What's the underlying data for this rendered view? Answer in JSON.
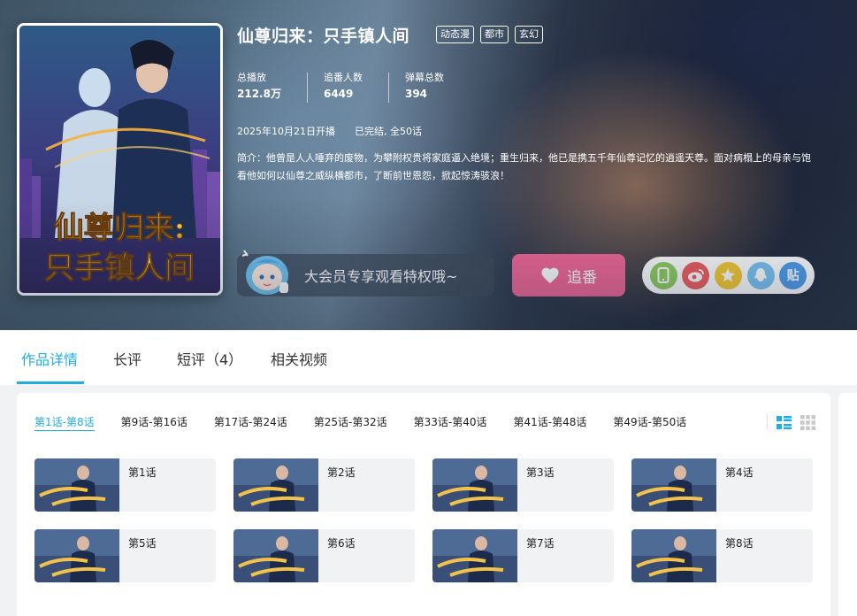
{
  "show": {
    "title": "仙尊归来：只手镇人间",
    "tags": [
      "动态漫",
      "都市",
      "玄幻"
    ],
    "cover_title_lines": [
      "仙尊归来:",
      "只手镇人间"
    ]
  },
  "stats": [
    {
      "label": "总播放",
      "value": "212.8万"
    },
    {
      "label": "追番人数",
      "value": "6449"
    },
    {
      "label": "弹幕总数",
      "value": "394"
    }
  ],
  "meta": {
    "premiere": "2025年10月21日开播",
    "status": "已完结, 全50话"
  },
  "description": {
    "line1": "简介：他曾是人人唾弃的废物，为攀附权贵将家庭逼入绝境；重生归来，他已是携五千年仙尊记忆的逍遥天尊。面对病榻上的母亲与饱",
    "line2": "看他如何以仙尊之威纵横都市，了断前世恩怨，掀起惊涛骇浪！"
  },
  "actions": {
    "vip_text": "大会员专享观看特权哦~",
    "follow_label": "追番",
    "share_icons": [
      {
        "name": "phone-icon",
        "color": "#8ccc5c"
      },
      {
        "name": "weibo-icon",
        "color": "#ee5b5b"
      },
      {
        "name": "qzone-icon",
        "color": "#f5c92e"
      },
      {
        "name": "qq-icon",
        "color": "#79c3f2"
      },
      {
        "name": "tieba-icon",
        "color": "#4c9bea",
        "glyph": "贴"
      }
    ]
  },
  "tabs": [
    {
      "label": "作品详情",
      "active": true
    },
    {
      "label": "长评"
    },
    {
      "label": "短评（4）"
    },
    {
      "label": "相关视频"
    }
  ],
  "ranges": [
    {
      "label": "第1话-第8话",
      "active": true
    },
    {
      "label": "第9话-第16话"
    },
    {
      "label": "第17话-第24话"
    },
    {
      "label": "第25话-第32话"
    },
    {
      "label": "第33话-第40话"
    },
    {
      "label": "第41话-第48话"
    },
    {
      "label": "第49话-第50话"
    }
  ],
  "episodes": [
    "第1话",
    "第2话",
    "第3话",
    "第4话",
    "第5话",
    "第6话",
    "第7话",
    "第8话"
  ],
  "colors": {
    "accent": "#1eaee3",
    "follow": "#f06493"
  }
}
